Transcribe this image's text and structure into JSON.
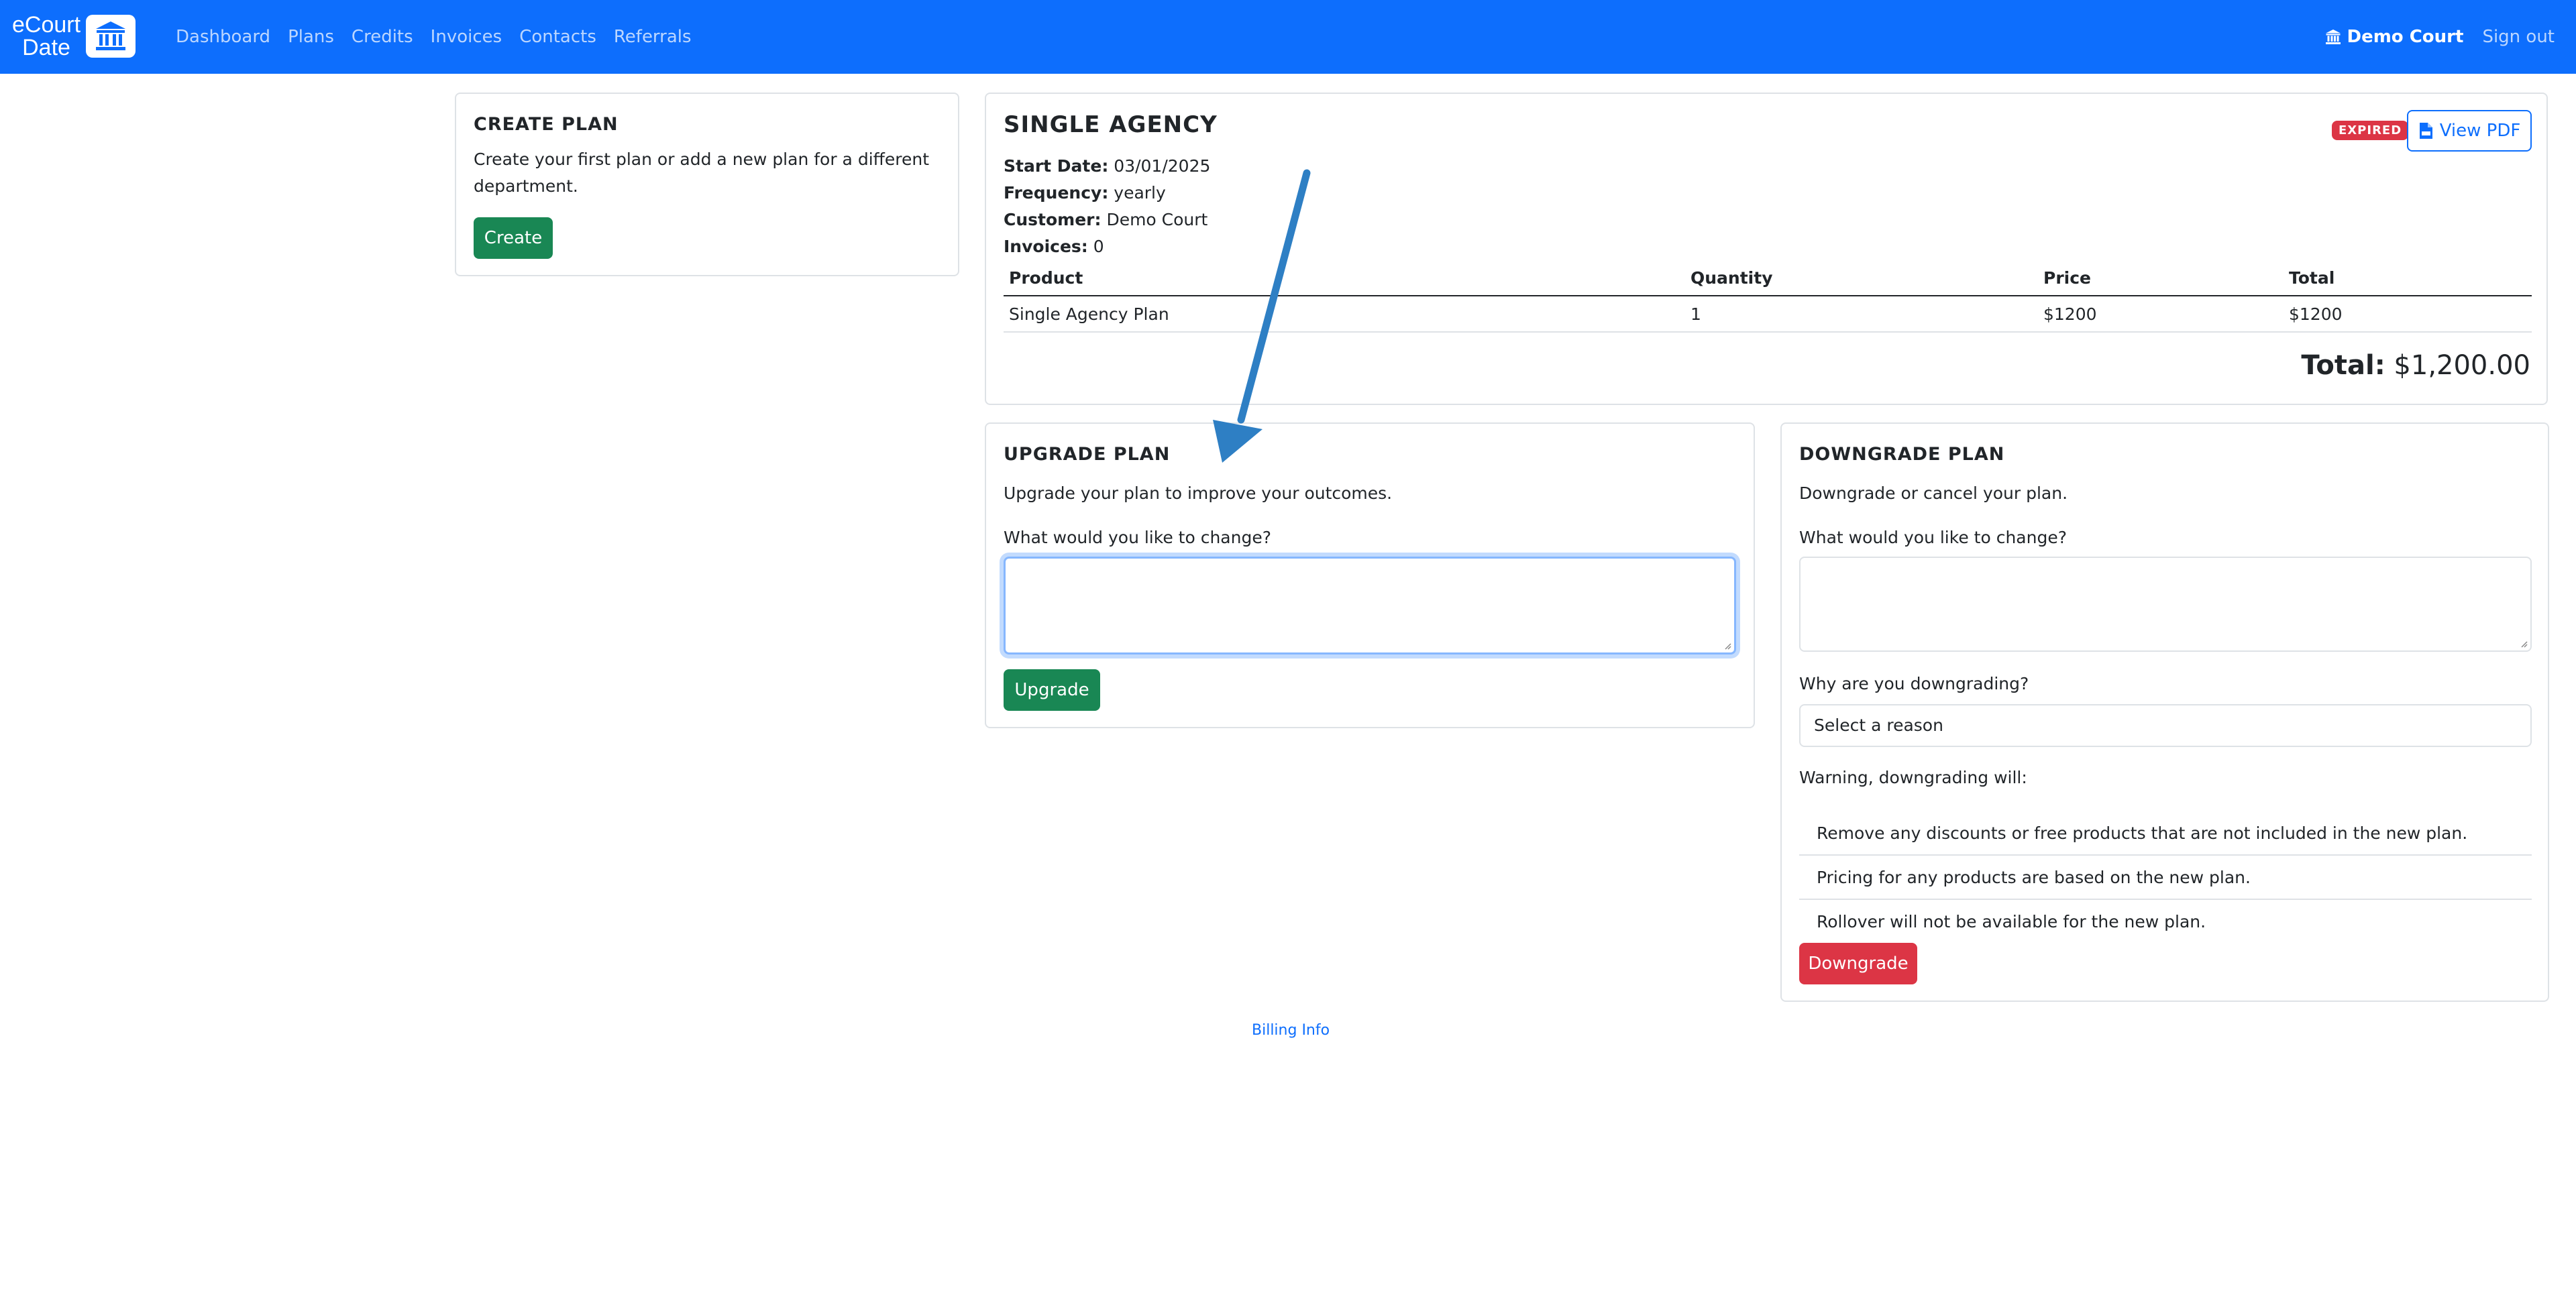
{
  "nav": {
    "logo_line1": "eCourt",
    "logo_line2": "Date",
    "links": [
      "Dashboard",
      "Plans",
      "Credits",
      "Invoices",
      "Contacts",
      "Referrals"
    ],
    "org_name": "Demo Court",
    "signout": "Sign out"
  },
  "create_plan": {
    "title": "CREATE PLAN",
    "description": "Create your first plan or add a new plan for a different department.",
    "button": "Create"
  },
  "plan": {
    "title": "SINGLE AGENCY",
    "status_badge": "EXPIRED",
    "pdf_button": "View PDF",
    "start_date_label": "Start Date:",
    "start_date": "03/01/2025",
    "frequency_label": "Frequency:",
    "frequency": "yearly",
    "customer_label": "Customer:",
    "customer": "Demo Court",
    "invoices_label": "Invoices:",
    "invoices": "0",
    "table": {
      "headers": [
        "Product",
        "Quantity",
        "Price",
        "Total"
      ],
      "rows": [
        [
          "Single Agency Plan",
          "1",
          "$1200",
          "$1200"
        ]
      ]
    },
    "total_label": "Total:",
    "total_value": "$1,200.00"
  },
  "upgrade": {
    "title": "UPGRADE PLAN",
    "description": "Upgrade your plan to improve your outcomes.",
    "change_label": "What would you like to change?",
    "change_value": "",
    "button": "Upgrade"
  },
  "downgrade": {
    "title": "DOWNGRADE PLAN",
    "description": "Downgrade or cancel your plan.",
    "change_label": "What would you like to change?",
    "change_value": "",
    "reason_label": "Why are you downgrading?",
    "reason_selected": "Select a reason",
    "warning_label": "Warning, downgrading will:",
    "warnings": [
      "Remove any discounts or free products that are not included in the new plan.",
      "Pricing for any products are based on the new plan.",
      "Rollover will not be available for the new plan."
    ],
    "button": "Downgrade"
  },
  "footer": {
    "billing_link": "Billing Info"
  },
  "colors": {
    "primary": "#0d6efd",
    "success": "#198754",
    "danger": "#dc3545",
    "annotation_arrow": "#2e7fc4"
  },
  "icons": {
    "logo": "courthouse-icon",
    "org": "courthouse-icon",
    "pdf": "file-pdf-icon"
  }
}
